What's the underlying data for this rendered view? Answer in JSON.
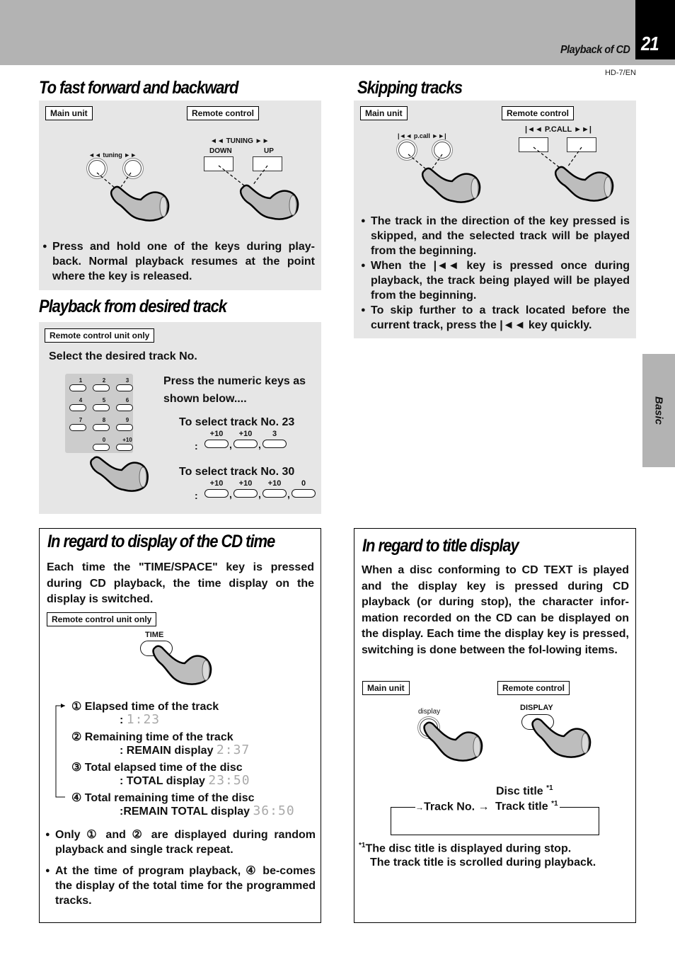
{
  "header": {
    "section_label": "Playback of CD",
    "page_number": "21",
    "model_code": "HD-7/EN"
  },
  "side_tab": {
    "label": "Basic"
  },
  "fast_forward": {
    "title": "To fast forward and backward",
    "main_unit_tag": "Main unit",
    "remote_tag": "Remote control",
    "main_key_label": "◄◄ tuning ►►",
    "remote_key_label": "◄◄ TUNING ►►",
    "remote_down": "DOWN",
    "remote_up": "UP",
    "bullets": [
      "Press and hold one of the keys during play-back. Normal playback resumes at the point where the key is released."
    ]
  },
  "skipping": {
    "title": "Skipping tracks",
    "main_unit_tag": "Main unit",
    "remote_tag": "Remote control",
    "main_key_label": "|◄◄ p.call ►►|",
    "remote_key_label": "|◄◄ P.CALL ►►|",
    "bullets": [
      "The track in the direction of the key pressed is  skipped, and the selected track will be played from  the beginning.",
      "When the |◄◄ key is pressed once during playback, the track being played will be played from the beginning.",
      "To skip further to a track located before the current track, press the |◄◄ key quickly."
    ]
  },
  "desired_track": {
    "title": "Playback from desired track",
    "tag": "Remote control unit only",
    "instruction": "Select the desired track No.",
    "keypad": [
      "1",
      "2",
      "3",
      "4",
      "5",
      "6",
      "7",
      "8",
      "9",
      "0",
      "+10"
    ],
    "press_text_1": "Press the numeric keys as",
    "press_text_2": "shown below....",
    "examples": [
      {
        "label": "To select track No. 23",
        "keys": [
          "+10",
          "+10",
          "3"
        ]
      },
      {
        "label": "To select track No. 30",
        "keys": [
          "+10",
          "+10",
          "+10",
          "0"
        ]
      }
    ]
  },
  "cd_time": {
    "title": "In regard to display of the CD time",
    "intro": "Each time the \"TIME/SPACE\" key is pressed during CD playback, the time display on the display is switched.",
    "tag": "Remote control unit only",
    "key_label": "TIME",
    "steps": [
      {
        "num": "①",
        "label": "Elapsed time of the track",
        "sub": ":",
        "value": "1:23"
      },
      {
        "num": "②",
        "label": "Remaining time of the track",
        "sub": ": REMAIN display",
        "value": "2:37"
      },
      {
        "num": "③",
        "label": "Total elapsed time of the disc",
        "sub": ": TOTAL display",
        "value": "23:50"
      },
      {
        "num": "④",
        "label": "Total remaining time of the disc",
        "sub": ":REMAIN  TOTAL display",
        "value": "36:50"
      }
    ],
    "bullets": [
      "Only ① and ② are displayed during random playback and single track repeat.",
      "At the time of program playback, ④ be-comes the display of the total time for the programmed tracks."
    ]
  },
  "title_display": {
    "title": "In regard to title display",
    "intro": "When a disc conforming to CD TEXT is played and the display key is pressed during CD playback (or during stop), the character infor-mation recorded on the CD can be displayed on the display. Each time the display key is pressed, switching is done between the fol-lowing items.",
    "main_unit_tag": "Main unit",
    "remote_tag": "Remote control",
    "main_key_label": "display",
    "remote_key_label": "DISPLAY",
    "flow": {
      "disc_title": "Disc title",
      "track_no": "Track No.",
      "arrow": "→",
      "track_title": "Track title",
      "footnote_mark": "*1"
    },
    "footnote_mark": "*1",
    "footnote_line1": "The disc title is displayed during stop.",
    "footnote_line2": "The track title is scrolled during playback."
  }
}
